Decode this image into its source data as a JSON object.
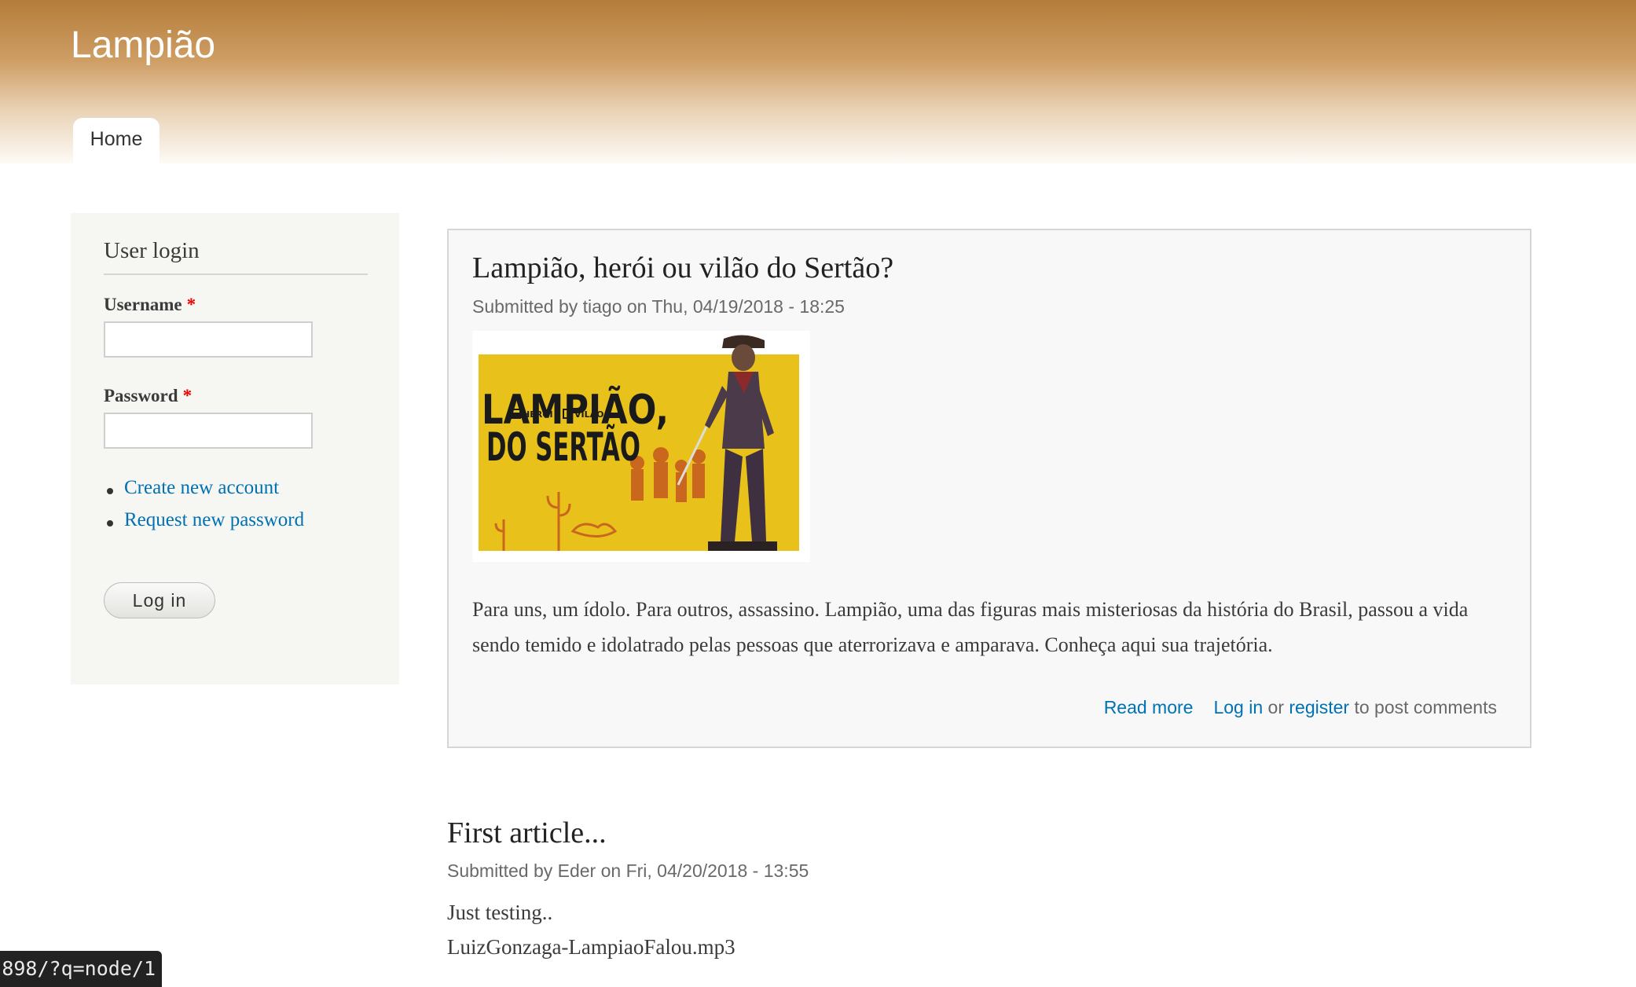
{
  "site": {
    "name": "Lampião"
  },
  "nav": {
    "tabs": [
      {
        "label": "Home"
      }
    ]
  },
  "sidebar": {
    "block_title": "User login",
    "username_label": "Username",
    "password_label": "Password",
    "required_marker": "*",
    "links": [
      {
        "label": "Create new account"
      },
      {
        "label": "Request new password"
      }
    ],
    "login_button": "Log in"
  },
  "articles": [
    {
      "title": "Lampião, herói ou vilão do Sertão?",
      "submitted": "Submitted by tiago on Thu, 04/19/2018 - 18:25",
      "image": {
        "title_line1": "LAMPIÃO,",
        "option1": "HERÓI",
        "option2": "VILÃO",
        "title_line2": "DO SERTÃO"
      },
      "body": "Para uns, um ídolo. Para outros, assassino. Lampião, uma das figuras mais misteriosas da história do Brasil, passou a vida sendo temido e idolatrado pelas pessoas que aterrorizava e amparava. Conheça aqui sua trajetória.",
      "links": {
        "read_more": "Read more",
        "log_in": "Log in",
        "or": "or",
        "register": "register",
        "post_comments": "to post comments"
      }
    },
    {
      "title": "First article...",
      "submitted": "Submitted by Eder on Fri, 04/20/2018 - 13:55",
      "body": "Just testing..",
      "attachment": "LuizGonzaga-LampiaoFalou.mp3"
    }
  ],
  "status_bar": {
    "url": "898/?q=node/1"
  },
  "colors": {
    "header_top": "#b47c39",
    "link": "#0071b3",
    "required": "#e00000",
    "image_yellow": "#e8c21a"
  }
}
